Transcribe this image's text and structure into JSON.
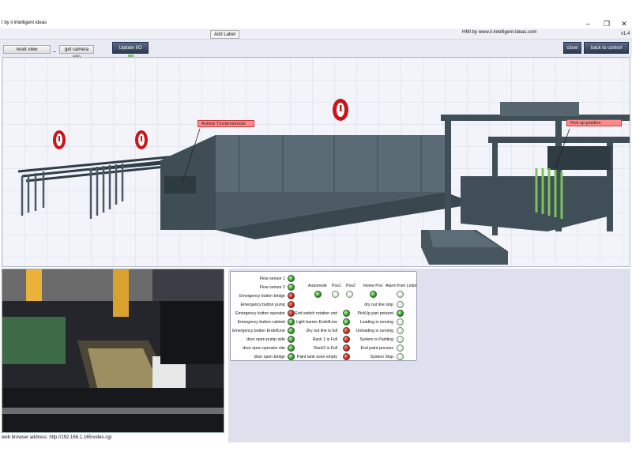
{
  "window": {
    "title": "t by ii intelligent ideas",
    "minimize": "–",
    "restore": "❐",
    "close": "✕"
  },
  "toolstrip": {
    "add_label": "Add Label",
    "hmi_text": "HMI by  www.ii-intelligent-ideas.com",
    "version": "v1.4"
  },
  "buttons": {
    "reset_view": "reset view",
    "separator": "_",
    "get_camera_info": "get camera info",
    "update_io": "Update I/O",
    "close": "close",
    "back_to_control": "back to control"
  },
  "model_labels": {
    "drive": "Antrieb Trockenstrecke",
    "pickup": "Pick up position"
  },
  "camera": {
    "address": "web browser address: http://192.168.1.165/video.cgi"
  },
  "io": {
    "left_column": [
      {
        "label": "Flow sensor 1",
        "state": "green"
      },
      {
        "label": "Flow sensor 2",
        "state": "green"
      },
      {
        "label": "Emergency button bridge",
        "state": "red"
      },
      {
        "label": "Emergency button pump",
        "state": "red"
      },
      {
        "label": "Emergency button operator",
        "state": "red"
      },
      {
        "label": "Emergency button cabinet",
        "state": "green"
      },
      {
        "label": "Emergency button EndofLine",
        "state": "green"
      },
      {
        "label": "door open pump side",
        "state": "green"
      },
      {
        "label": "door open operator site",
        "state": "green"
      },
      {
        "label": "door open bridge",
        "state": "green"
      }
    ],
    "top_headers": [
      {
        "label": "Automode",
        "state": "green"
      },
      {
        "label": "Pos1",
        "state": "off"
      },
      {
        "label": "Pos2",
        "state": "off"
      },
      {
        "label": "Home Pos",
        "state": "green"
      },
      {
        "label": "Alarm from Leitst",
        "state": "off"
      }
    ],
    "middle_column": [
      {
        "label": "End switch rotation unit",
        "state": "green"
      },
      {
        "label": "Light barrier EndofLine",
        "state": "green"
      },
      {
        "label": "Dry out line is full",
        "state": "red"
      },
      {
        "label": "Rack 1 is Full",
        "state": "red"
      },
      {
        "label": "Rack2 is Full",
        "state": "red"
      },
      {
        "label": "Paint tank soon empty",
        "state": "red"
      }
    ],
    "right_column": [
      {
        "label": "dry out line stop",
        "state": "off"
      },
      {
        "label": "PickUp part present",
        "state": "green"
      },
      {
        "label": "Loading is running",
        "state": "off"
      },
      {
        "label": "Unloading is running",
        "state": "off"
      },
      {
        "label": "System is Painting",
        "state": "off"
      },
      {
        "label": "End paint process",
        "state": "off"
      },
      {
        "label": "System Stop",
        "state": "off"
      }
    ]
  }
}
